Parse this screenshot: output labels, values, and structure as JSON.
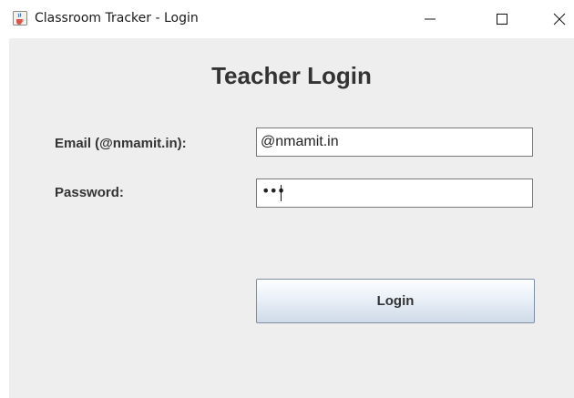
{
  "window": {
    "title": "Classroom Tracker - Login",
    "app_icon": "java-cup-icon",
    "controls": [
      "minimize-icon",
      "maximize-icon",
      "close-icon"
    ]
  },
  "form": {
    "heading": "Teacher Login",
    "email_label": "Email (@nmamit.in):",
    "email_value": "@nmamit.in",
    "password_label": "Password:",
    "password_mask": "•••",
    "login_label": "Login"
  },
  "colors": {
    "panel_background": "#eeeeee",
    "text": "#333333",
    "button_gradient_top": "#fdfeff",
    "button_gradient_bottom": "#cfdbe8"
  }
}
